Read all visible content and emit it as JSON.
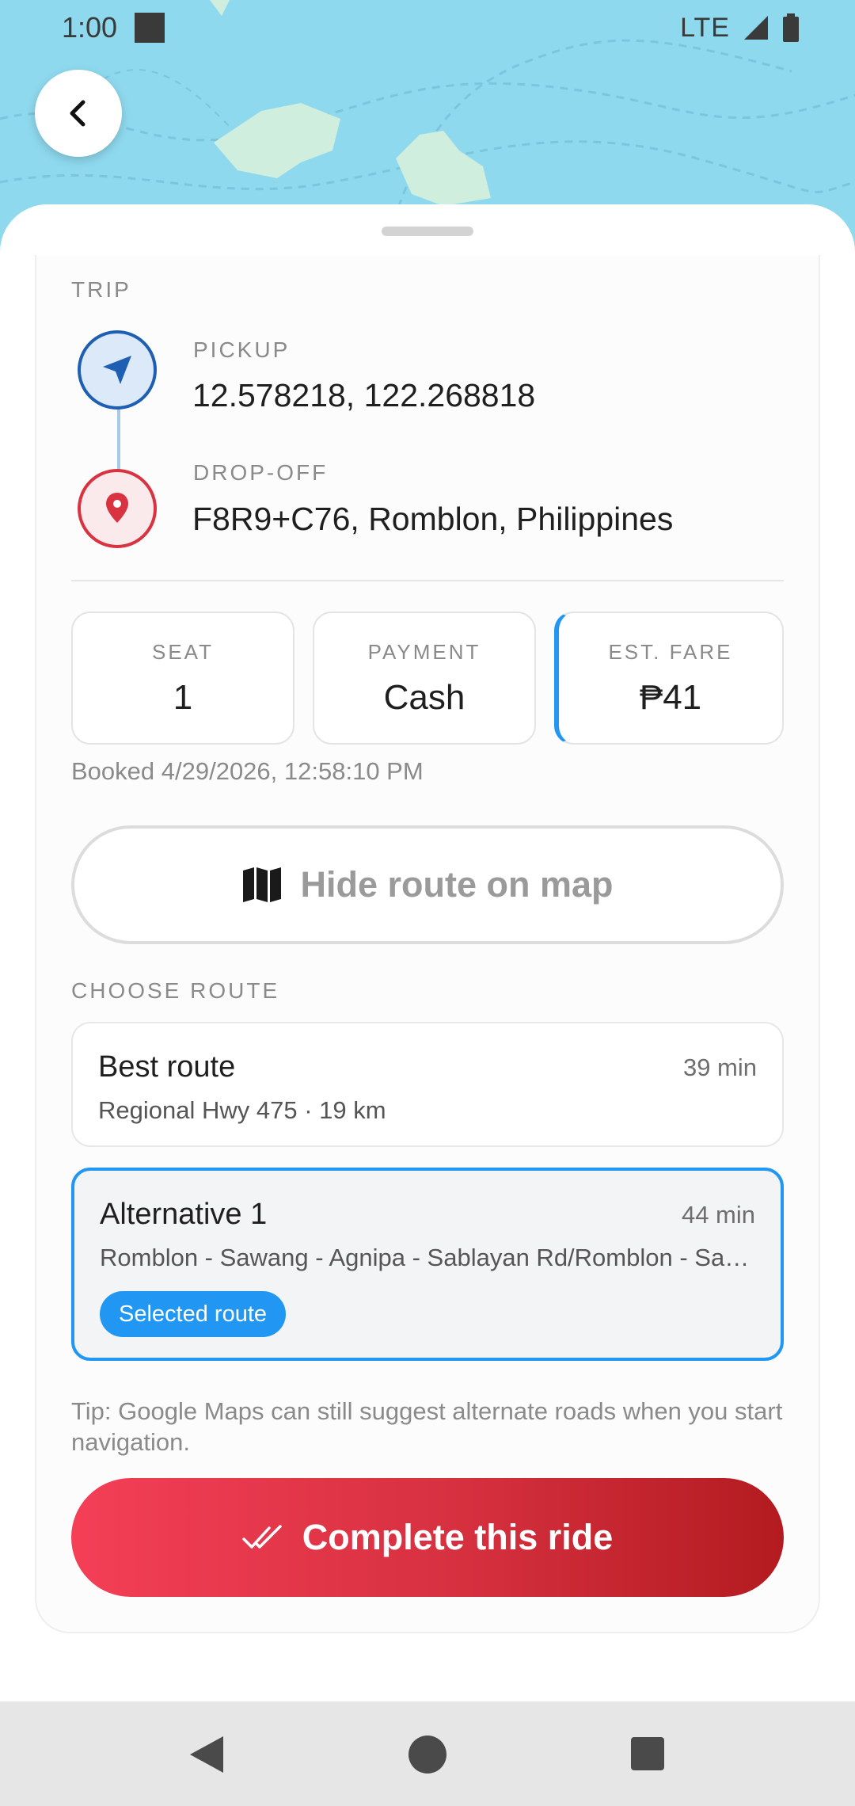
{
  "status_bar": {
    "time": "1:00",
    "network": "LTE"
  },
  "trip": {
    "section_label": "TRIP",
    "pickup_label": "PICKUP",
    "pickup_value": "12.578218, 122.268818",
    "dropoff_label": "DROP-OFF",
    "dropoff_value": "F8R9+C76, Romblon, Philippines"
  },
  "stats": {
    "seat_label": "SEAT",
    "seat_value": "1",
    "payment_label": "PAYMENT",
    "payment_value": "Cash",
    "fare_label": "EST. FARE",
    "fare_value": "₱41"
  },
  "booked": "Booked 4/29/2026, 12:58:10 PM",
  "hide_route_label": "Hide route on map",
  "choose_route_label": "CHOOSE ROUTE",
  "routes": [
    {
      "title": "Best route",
      "time": "39 min",
      "desc": "Regional Hwy 475 · 19 km"
    },
    {
      "title": "Alternative 1",
      "time": "44 min",
      "desc": "Romblon - Sawang - Agnipa - Sablayan Rd/Romblon - Sawang Rd",
      "badge": "Selected route"
    }
  ],
  "tip": "Tip: Google Maps can still suggest alternate roads when you start navigation.",
  "complete_label": "Complete this ride",
  "colors": {
    "accent_blue": "#2196f3",
    "pickup_blue": "#1e5fb3",
    "dropoff_red": "#d93240",
    "cta_start": "#f43f57",
    "cta_end": "#b31b20"
  }
}
